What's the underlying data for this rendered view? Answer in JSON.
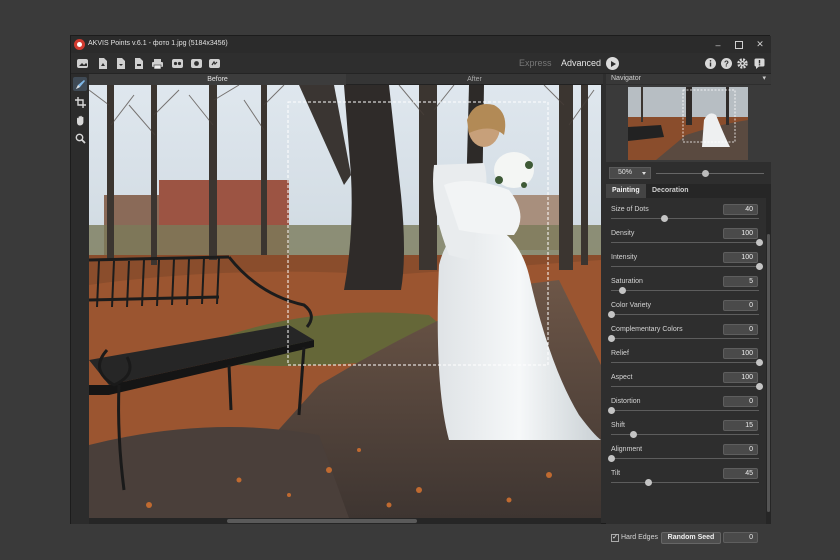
{
  "window": {
    "title": "AKVIS Points v.6.1 - фото 1.jpg (5184x3456)",
    "controls": [
      "minimize-icon",
      "maximize-icon",
      "close-icon"
    ]
  },
  "toolbar": {
    "left_icons": [
      "open-image-icon",
      "open-file-icon",
      "save-file-icon",
      "export-file-icon",
      "print-icon",
      "batch-icon",
      "presets-icon",
      "share-icon"
    ],
    "mode_express": "Express",
    "mode_advanced": "Advanced",
    "right_icons": [
      "info-icon",
      "help-icon",
      "settings-icon",
      "notification-icon"
    ]
  },
  "left_tools": [
    "brush-tool-icon",
    "crop-tool-icon",
    "hand-tool-icon",
    "zoom-tool-icon"
  ],
  "view_tabs": {
    "before": "Before",
    "after": "After",
    "active": "before"
  },
  "navigator": {
    "title": "Navigator",
    "menu_icon": "chevron-down-icon"
  },
  "zoom": {
    "label": "50%",
    "slider_fraction": 0.46
  },
  "panel_tabs": {
    "painting": "Painting",
    "decoration": "Decoration",
    "active": "painting"
  },
  "parameters": [
    {
      "label": "Size of Dots",
      "value": "40",
      "fraction": 0.36
    },
    {
      "label": "Density",
      "value": "100",
      "fraction": 1.0
    },
    {
      "label": "Intensity",
      "value": "100",
      "fraction": 1.0
    },
    {
      "label": "Saturation",
      "value": "5",
      "fraction": 0.08
    },
    {
      "label": "Color Variety",
      "value": "0",
      "fraction": 0.0
    },
    {
      "label": "Complementary Colors",
      "value": "0",
      "fraction": 0.0
    },
    {
      "label": "Relief",
      "value": "100",
      "fraction": 1.0
    },
    {
      "label": "Aspect",
      "value": "100",
      "fraction": 1.0
    },
    {
      "label": "Distortion",
      "value": "0",
      "fraction": 0.0
    },
    {
      "label": "Shift",
      "value": "15",
      "fraction": 0.15
    },
    {
      "label": "Alignment",
      "value": "0",
      "fraction": 0.0
    },
    {
      "label": "Tilt",
      "value": "45",
      "fraction": 0.25
    }
  ],
  "hard_edges": {
    "label": "Hard Edges",
    "checked": true,
    "check_mark": "✓"
  },
  "random_seed": {
    "label": "Random Seed",
    "value": "0"
  }
}
